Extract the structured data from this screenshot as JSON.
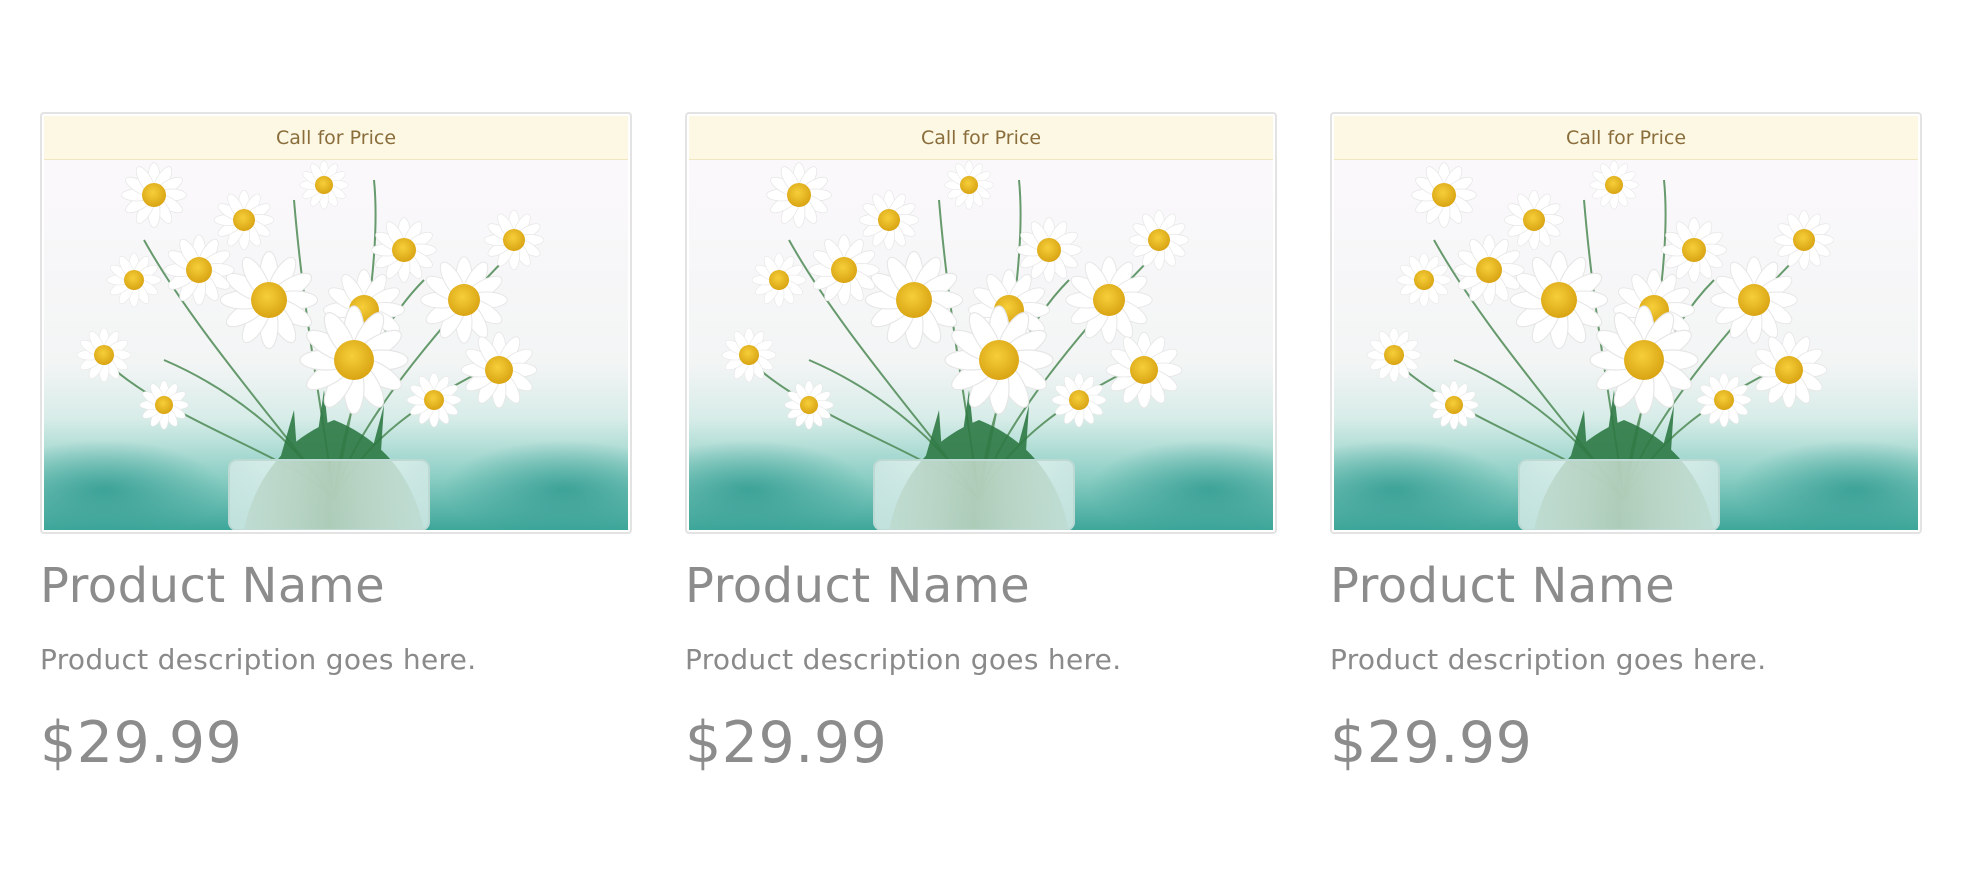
{
  "products": [
    {
      "banner": "Call for Price",
      "name": "Product Name",
      "description": "Product description goes here.",
      "price": "$29.99"
    },
    {
      "banner": "Call for Price",
      "name": "Product Name",
      "description": "Product description goes here.",
      "price": "$29.99"
    },
    {
      "banner": "Call for Price",
      "name": "Product Name",
      "description": "Product description goes here.",
      "price": "$29.99"
    }
  ],
  "colors": {
    "banner_bg": "#fcf8e3",
    "banner_text": "#8a6d3b",
    "text_muted": "#8c8c8c",
    "daisy_center": "#e8b81c",
    "foliage": "#2f7a45",
    "teal_background": "#3aa39a"
  },
  "image_subject": "daisy-bouquet-image"
}
